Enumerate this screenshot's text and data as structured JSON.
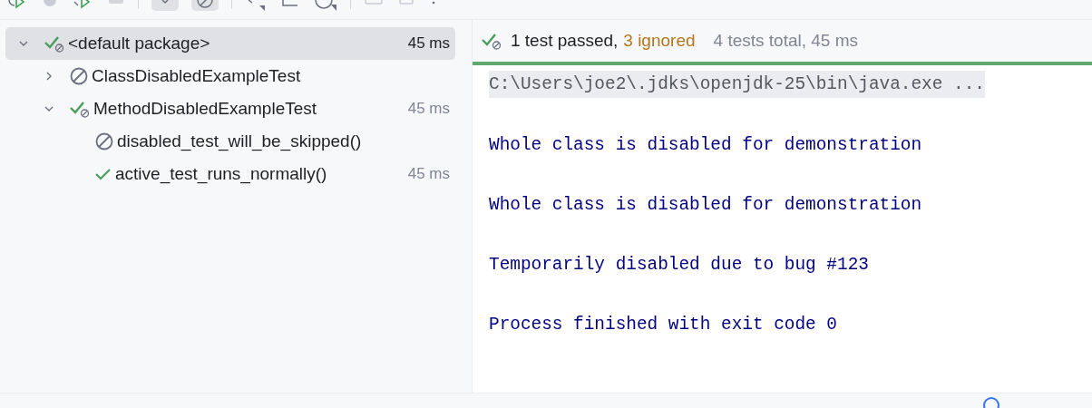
{
  "toolbar": {
    "toggles": [
      {
        "selected": true
      },
      {
        "selected": true
      }
    ]
  },
  "tree": [
    {
      "label": "<default package>",
      "kind": "passed-partial",
      "time": "45 ms",
      "selected": true,
      "expanded": true,
      "children": [
        {
          "label": "ClassDisabledExampleTest",
          "kind": "ignored",
          "selected": false,
          "expanded": false
        },
        {
          "label": "MethodDisabledExampleTest",
          "kind": "passed-partial",
          "time": "45 ms",
          "selected": false,
          "expanded": true,
          "children": [
            {
              "label": "disabled_test_will_be_skipped()",
              "kind": "ignored",
              "selected": false
            },
            {
              "label": "active_test_runs_normally()",
              "kind": "passed",
              "time": "45 ms",
              "selected": false
            }
          ]
        }
      ]
    }
  ],
  "summary": {
    "passed": "1 test passed,",
    "ignored": "3 ignored",
    "total": "4 tests total, 45 ms",
    "level": 1
  },
  "console": [
    {
      "text": "C:\\Users\\joe2\\.jdks\\openjdk-25\\bin\\java.exe ...",
      "kind": "command"
    },
    {
      "text": "Whole class is disabled for demonstration",
      "kind": "output"
    },
    {
      "text": "Whole class is disabled for demonstration",
      "kind": "output"
    },
    {
      "text": "Temporarily disabled due to bug #123",
      "kind": "output"
    },
    {
      "text": "Process finished with exit code 0",
      "kind": "output"
    }
  ]
}
